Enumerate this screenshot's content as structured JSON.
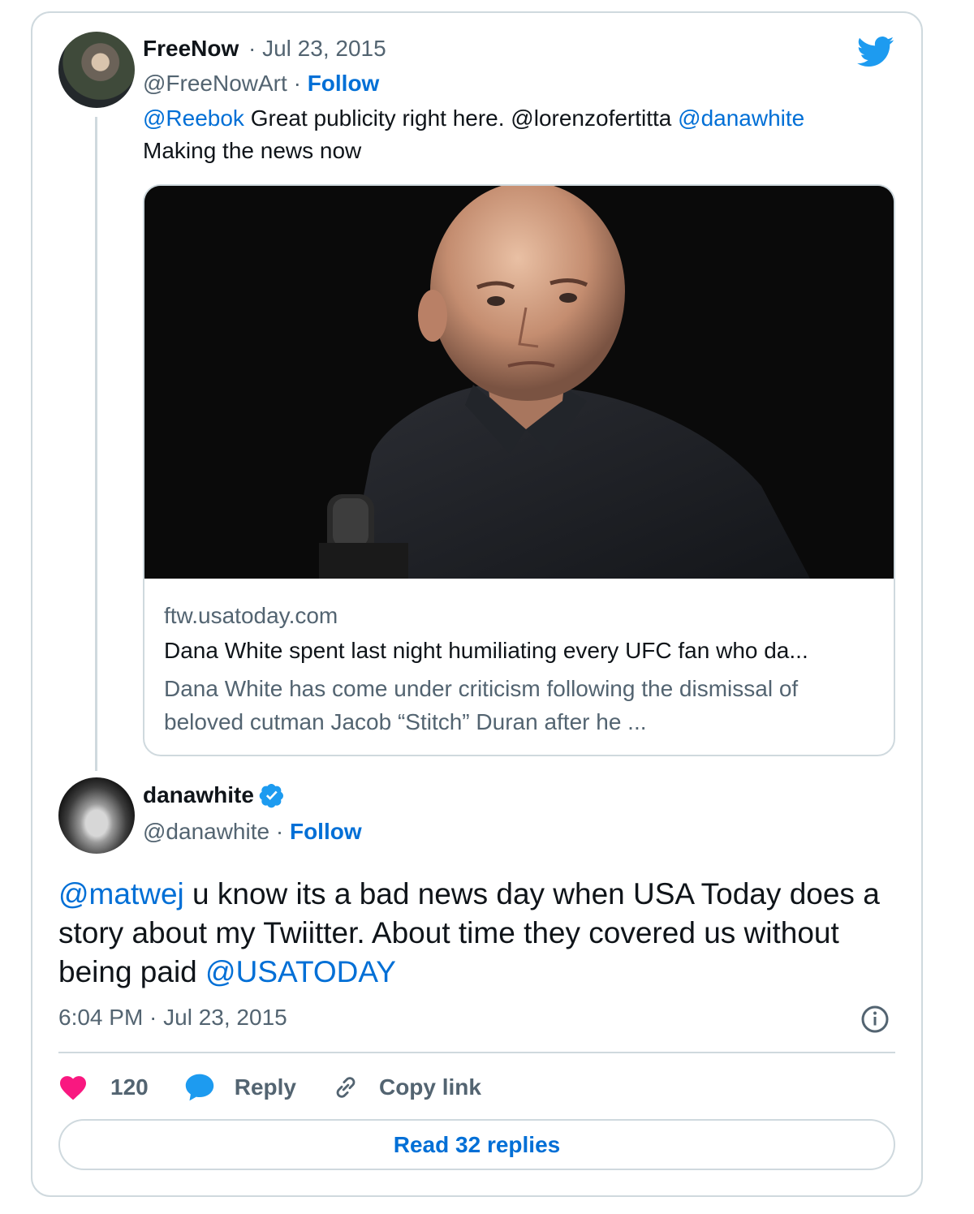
{
  "quoted_tweet": {
    "author_name": "FreeNow",
    "date": "· Jul 23, 2015",
    "handle": "@FreeNowArt",
    "separator": "·",
    "follow_label": "Follow",
    "text": {
      "mention_reebok": "@Reebok",
      "part1": " Great publicity right here. @lorenzofertitta ",
      "mention_dana": "@danawhite",
      "part2": "Making the news now"
    },
    "link_card": {
      "domain": "ftw.usatoday.com",
      "title": "Dana White spent last night humiliating every UFC fan who da...",
      "description": "Dana White has come under criticism following the dismissal of beloved cutman Jacob “Stitch” Duran after he ..."
    }
  },
  "main_tweet": {
    "author_name": "danawhite",
    "handle": "@danawhite",
    "separator": "·",
    "follow_label": "Follow",
    "text": {
      "mention_matwej": "@matwej",
      "body": " u know its a bad news day when USA Today does a story about my Twiitter. About time they covered us without being paid ",
      "mention_usatoday": "@USATODAY"
    },
    "timestamp": "6:04 PM · Jul 23, 2015"
  },
  "actions": {
    "likes_count": "120",
    "reply_label": "Reply",
    "copy_link_label": "Copy link"
  },
  "read_replies_label": "Read 32 replies",
  "colors": {
    "link_blue": "#006fd6",
    "twitter_blue": "#1d9bf0",
    "like_pink": "#f91880",
    "muted_gray": "#536471",
    "border": "#cfd9de"
  },
  "icons": [
    "twitter-bird-icon",
    "verified-badge-icon",
    "info-icon",
    "heart-icon",
    "reply-bubble-icon",
    "link-icon"
  ]
}
